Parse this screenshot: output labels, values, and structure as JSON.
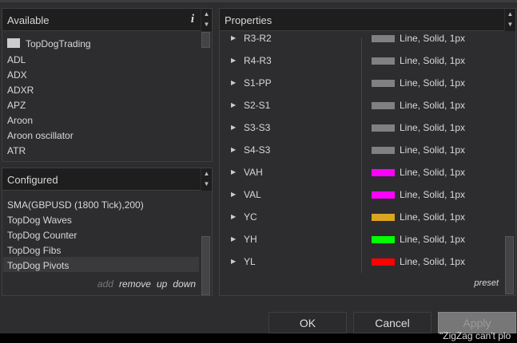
{
  "available": {
    "title": "Available",
    "info_icon": "i",
    "folder": "TopDogTrading",
    "items": [
      "ADL",
      "ADX",
      "ADXR",
      "APZ",
      "Aroon",
      "Aroon oscillator",
      "ATR"
    ]
  },
  "configured": {
    "title": "Configured",
    "items": [
      "SMA(GBPUSD (1800 Tick),200)",
      "TopDog Waves",
      "TopDog Counter",
      "TopDog Fibs",
      "TopDog Pivots"
    ],
    "selected": "TopDog Pivots",
    "actions": {
      "add": "add",
      "remove": "remove",
      "up": "up",
      "down": "down"
    }
  },
  "properties": {
    "title": "Properties",
    "preset": "preset",
    "rows": [
      {
        "name": "R3-R2",
        "value": "Line, Solid, 1px",
        "color": "#808080"
      },
      {
        "name": "R4-R3",
        "value": "Line, Solid, 1px",
        "color": "#808080"
      },
      {
        "name": "S1-PP",
        "value": "Line, Solid, 1px",
        "color": "#808080"
      },
      {
        "name": "S2-S1",
        "value": "Line, Solid, 1px",
        "color": "#808080"
      },
      {
        "name": "S3-S3",
        "value": "Line, Solid, 1px",
        "color": "#808080"
      },
      {
        "name": "S4-S3",
        "value": "Line, Solid, 1px",
        "color": "#808080"
      },
      {
        "name": "VAH",
        "value": "Line, Solid, 1px",
        "color": "#ff00ff"
      },
      {
        "name": "VAL",
        "value": "Line, Solid, 1px",
        "color": "#ff00ff"
      },
      {
        "name": "YC",
        "value": "Line, Solid, 1px",
        "color": "#daa520"
      },
      {
        "name": "YH",
        "value": "Line, Solid, 1px",
        "color": "#00ff00"
      },
      {
        "name": "YL",
        "value": "Line, Solid, 1px",
        "color": "#ff0000"
      }
    ]
  },
  "buttons": {
    "ok": "OK",
    "cancel": "Cancel",
    "apply": "Apply"
  },
  "background_text": "\"ZigZag can't plo"
}
